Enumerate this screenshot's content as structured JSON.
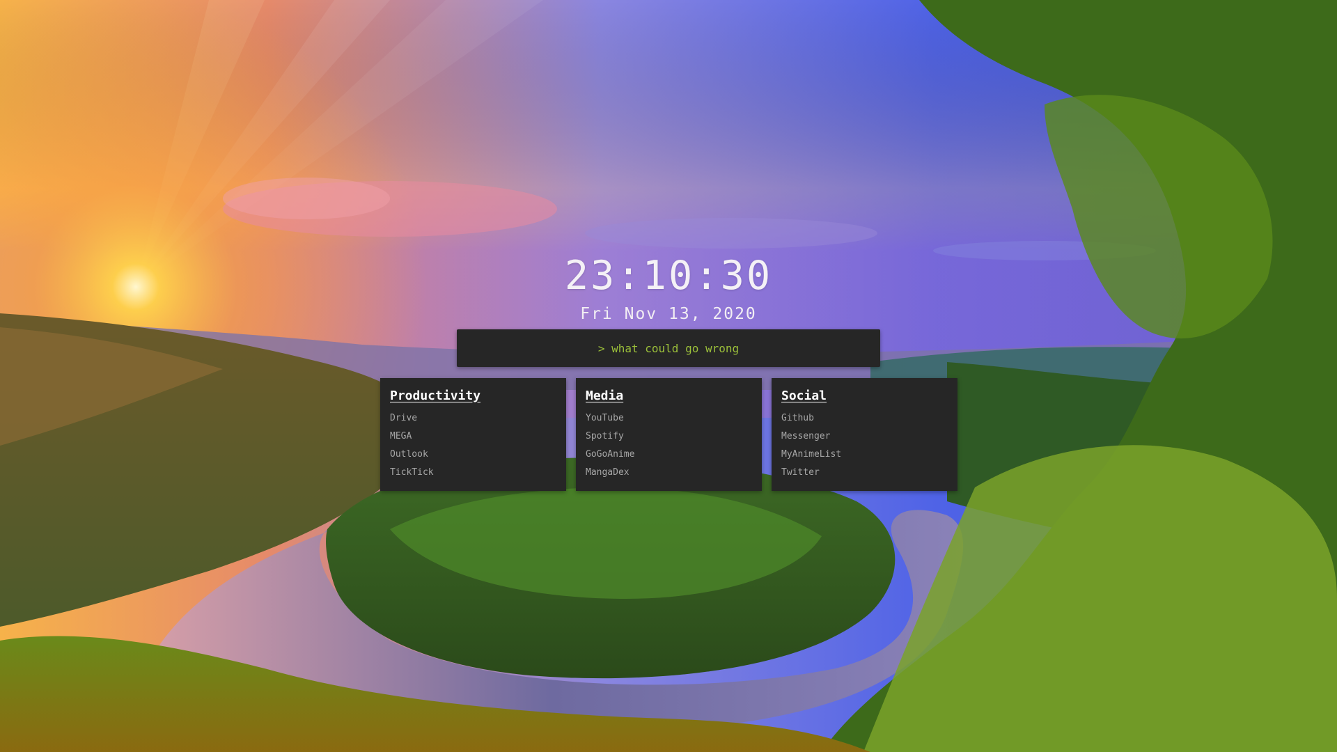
{
  "clock": {
    "time": "23:10:30",
    "date": "Fri Nov 13, 2020"
  },
  "search": {
    "placeholder": "> what could go wrong"
  },
  "colors": {
    "panel": "#262626",
    "accent_green": "#9bbf3a",
    "link": "#a7a7a7",
    "heading": "#ffffff"
  },
  "cards": [
    {
      "title": "Productivity",
      "links": [
        "Drive",
        "MEGA",
        "Outlook",
        "TickTick"
      ]
    },
    {
      "title": "Media",
      "links": [
        "YouTube",
        "Spotify",
        "GoGoAnime",
        "MangaDex"
      ]
    },
    {
      "title": "Social",
      "links": [
        "Github",
        "Messenger",
        "MyAnimeList",
        "Twitter"
      ]
    }
  ]
}
